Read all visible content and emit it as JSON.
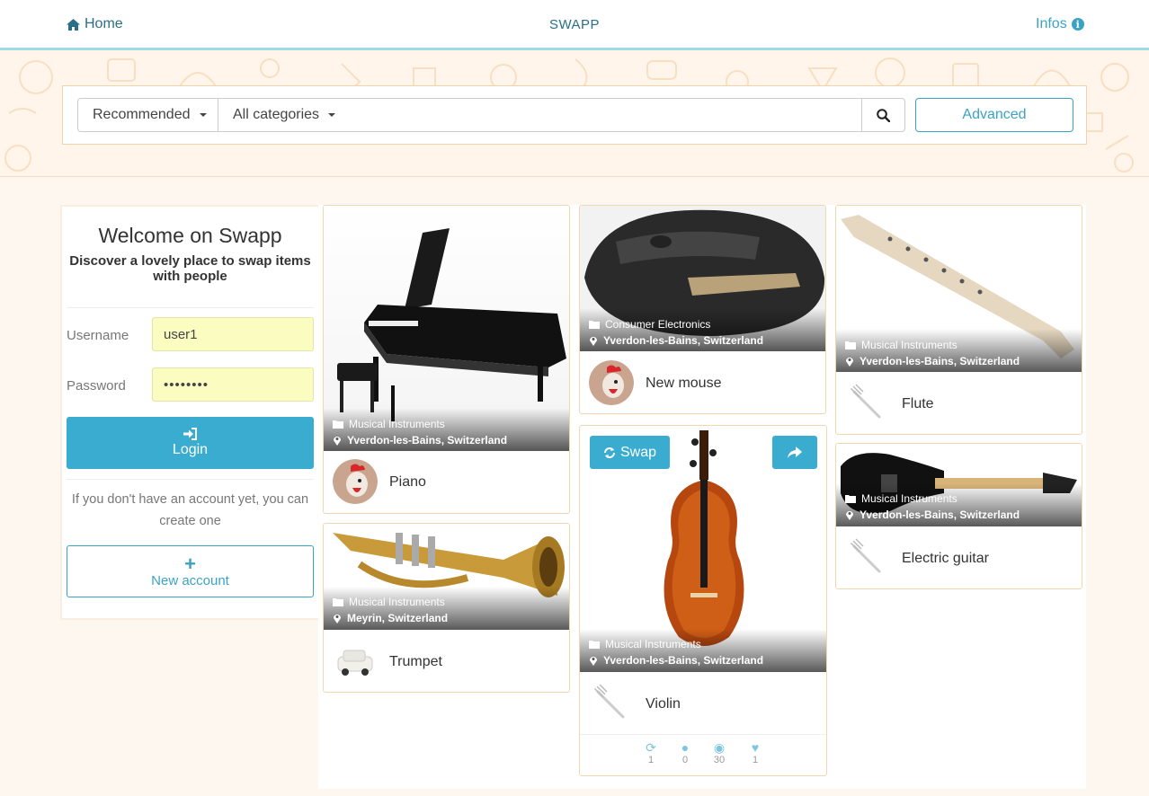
{
  "nav": {
    "home_label": "Home",
    "title": "SWAPP",
    "infos_label": "Infos"
  },
  "search": {
    "sort_value": "Recommended",
    "category_value": "All categories",
    "query_value": "",
    "advanced_label": "Advanced"
  },
  "sidebar": {
    "title": "Welcome on Swapp",
    "subtitle": "Discover a lovely place to swap items with people",
    "username_label": "Username",
    "username_value": "user1",
    "password_label": "Password",
    "password_value": "••••••••",
    "login_label": "Login",
    "no_account_text": "If you don't have an account yet, you can create one",
    "new_account_label": "New account"
  },
  "items": [
    {
      "name": "Piano",
      "category": "Musical Instruments",
      "location": "Yverdon-les-Bains, Switzerland",
      "owner_avatar": "rooster"
    },
    {
      "name": "Trumpet",
      "category": "Musical Instruments",
      "location": "Meyrin, Switzerland",
      "owner_avatar": "car"
    },
    {
      "name": "New mouse",
      "category": "Consumer Electronics",
      "location": "Yverdon-les-Bains, Switzerland",
      "owner_avatar": "rooster"
    },
    {
      "name": "Violin",
      "category": "Musical Instruments",
      "location": "Yverdon-les-Bains, Switzerland",
      "owner_avatar": "fork"
    },
    {
      "name": "Flute",
      "category": "Musical Instruments",
      "location": "Yverdon-les-Bains, Switzerland",
      "owner_avatar": "fork"
    },
    {
      "name": "Electric guitar",
      "category": "Musical Instruments",
      "location": "Yverdon-les-Bains, Switzerland",
      "owner_avatar": "fork"
    }
  ],
  "featured": {
    "swap_label": "Swap",
    "stats": {
      "swaps": "1",
      "comments": "0",
      "views": "30",
      "likes": "1"
    }
  },
  "colors": {
    "accent": "#3aacd0",
    "nav_text": "#2b6f86",
    "hero_bg": "#fff5ea",
    "page_bg": "#fdf7ef"
  }
}
